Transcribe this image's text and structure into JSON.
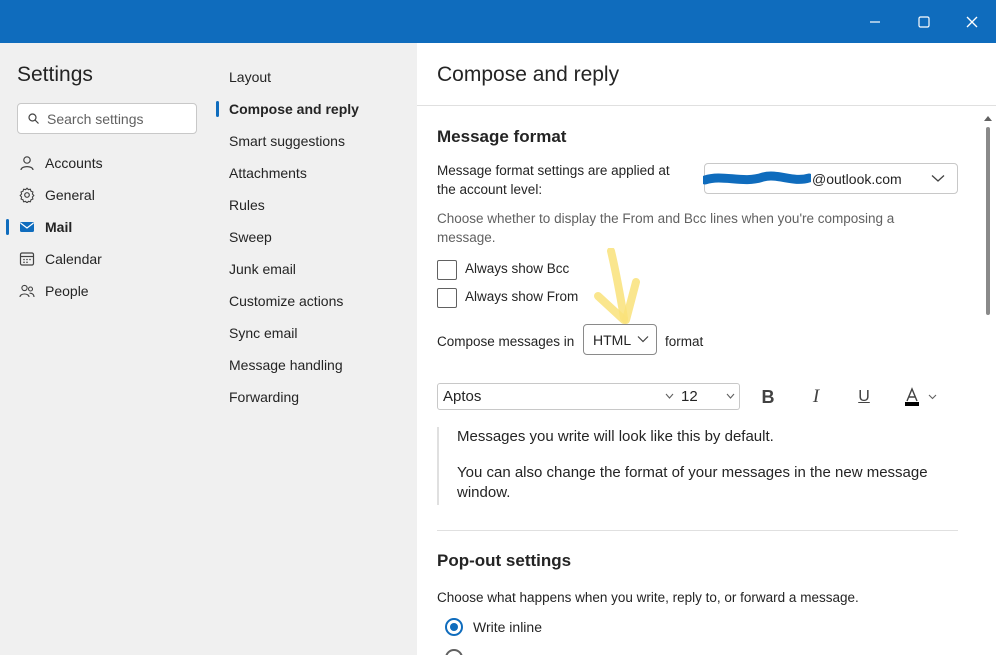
{
  "window": {
    "min_icon": "minimize-icon",
    "max_icon": "maximize-icon",
    "close_icon": "close-icon",
    "titlebar_color": "#0f6cbd"
  },
  "sidebar": {
    "title": "Settings",
    "search_placeholder": "Search settings",
    "items": [
      {
        "label": "Accounts",
        "icon": "person-icon"
      },
      {
        "label": "General",
        "icon": "gear-icon"
      },
      {
        "label": "Mail",
        "icon": "mail-icon",
        "selected": true
      },
      {
        "label": "Calendar",
        "icon": "calendar-icon"
      },
      {
        "label": "People",
        "icon": "people-icon"
      }
    ]
  },
  "submenu": {
    "items": [
      {
        "label": "Layout"
      },
      {
        "label": "Compose and reply",
        "selected": true
      },
      {
        "label": "Smart suggestions"
      },
      {
        "label": "Attachments"
      },
      {
        "label": "Rules"
      },
      {
        "label": "Sweep"
      },
      {
        "label": "Junk email"
      },
      {
        "label": "Customize actions"
      },
      {
        "label": "Sync email"
      },
      {
        "label": "Message handling"
      },
      {
        "label": "Forwarding"
      }
    ]
  },
  "main": {
    "title": "Compose and reply",
    "message_format": {
      "heading": "Message format",
      "account_label_line1": "Message format settings are applied at",
      "account_label_line2": "the account level:",
      "account_value": "@outlook.com",
      "desc_line1": "Choose whether to display the From and Bcc lines when you're composing a",
      "desc_line2": "message.",
      "always_bcc": {
        "label": "Always show Bcc",
        "checked": false
      },
      "always_from": {
        "label": "Always show From",
        "checked": false
      },
      "compose_prefix": "Compose messages in",
      "compose_format": "HTML",
      "compose_suffix": "format",
      "font_name": "Aptos",
      "font_size": "12",
      "bold_label": "B",
      "italic_label": "I",
      "underline_label": "U",
      "font_color_icon": "font-color-icon",
      "preview_line1": "Messages you write will look like this by default.",
      "preview_line2a": "You can also change the format of your messages in the new message",
      "preview_line2b": "window."
    },
    "popout": {
      "heading": "Pop-out settings",
      "desc": "Choose what happens when you write, reply to, or forward a message.",
      "options": [
        {
          "label": "Write inline",
          "selected": true
        }
      ]
    }
  },
  "colors": {
    "accent": "#0f6cbd",
    "pane_bg": "#f0f0f0",
    "annotation": "#f9e27a"
  }
}
